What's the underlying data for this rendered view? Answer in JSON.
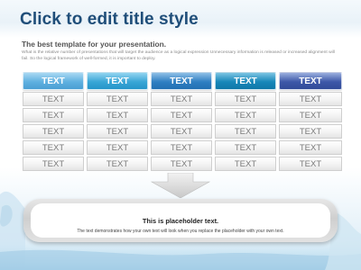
{
  "slide": {
    "title": "Click to edit title style",
    "subtitle": "The best template for your presentation.",
    "body": "What is the relative number of presentations that will target the audience as a logical expression Unnecessary information is released or increased alignment will fail. So the logical framework of well-formed, it is important to deploy.",
    "colors": {
      "title": "#1f4e79",
      "header_1": "#5fb0e0",
      "header_2": "#39a6d6",
      "header_3": "#2f7fc2",
      "header_4": "#1787b9",
      "header_5": "#3d58a8"
    }
  },
  "table": {
    "headers": [
      "TEXT",
      "TEXT",
      "TEXT",
      "TEXT",
      "TEXT"
    ],
    "rows": [
      [
        "TEXT",
        "TEXT",
        "TEXT",
        "TEXT",
        "TEXT"
      ],
      [
        "TEXT",
        "TEXT",
        "TEXT",
        "TEXT",
        "TEXT"
      ],
      [
        "TEXT",
        "TEXT",
        "TEXT",
        "TEXT",
        "TEXT"
      ],
      [
        "TEXT",
        "TEXT",
        "TEXT",
        "TEXT",
        "TEXT"
      ],
      [
        "TEXT",
        "TEXT",
        "TEXT",
        "TEXT",
        "TEXT"
      ]
    ]
  },
  "callout": {
    "title": "This is placeholder text.",
    "text": "The text demonstrates how your own text will look when you replace the placeholder with your own text."
  },
  "icons": [
    "down-arrow-icon"
  ]
}
